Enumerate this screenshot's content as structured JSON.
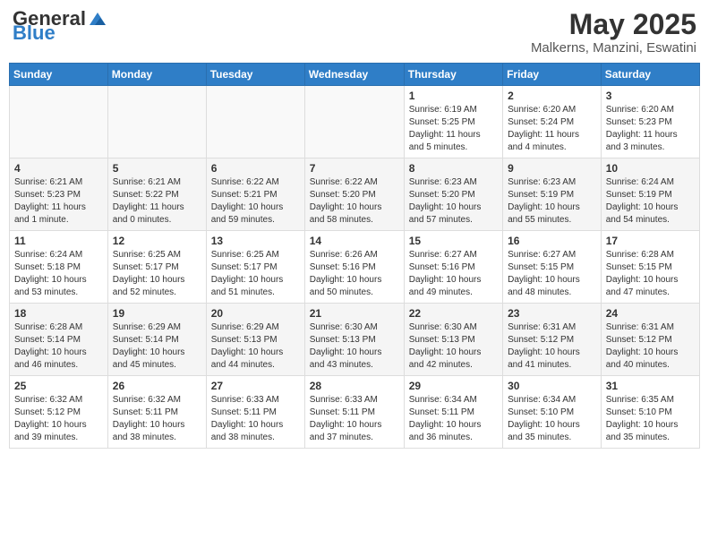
{
  "header": {
    "logo_general": "General",
    "logo_blue": "Blue",
    "month_title": "May 2025",
    "location": "Malkerns, Manzini, Eswatini"
  },
  "days_of_week": [
    "Sunday",
    "Monday",
    "Tuesday",
    "Wednesday",
    "Thursday",
    "Friday",
    "Saturday"
  ],
  "weeks": [
    [
      {
        "day": "",
        "info": ""
      },
      {
        "day": "",
        "info": ""
      },
      {
        "day": "",
        "info": ""
      },
      {
        "day": "",
        "info": ""
      },
      {
        "day": "1",
        "info": "Sunrise: 6:19 AM\nSunset: 5:25 PM\nDaylight: 11 hours\nand 5 minutes."
      },
      {
        "day": "2",
        "info": "Sunrise: 6:20 AM\nSunset: 5:24 PM\nDaylight: 11 hours\nand 4 minutes."
      },
      {
        "day": "3",
        "info": "Sunrise: 6:20 AM\nSunset: 5:23 PM\nDaylight: 11 hours\nand 3 minutes."
      }
    ],
    [
      {
        "day": "4",
        "info": "Sunrise: 6:21 AM\nSunset: 5:23 PM\nDaylight: 11 hours\nand 1 minute."
      },
      {
        "day": "5",
        "info": "Sunrise: 6:21 AM\nSunset: 5:22 PM\nDaylight: 11 hours\nand 0 minutes."
      },
      {
        "day": "6",
        "info": "Sunrise: 6:22 AM\nSunset: 5:21 PM\nDaylight: 10 hours\nand 59 minutes."
      },
      {
        "day": "7",
        "info": "Sunrise: 6:22 AM\nSunset: 5:20 PM\nDaylight: 10 hours\nand 58 minutes."
      },
      {
        "day": "8",
        "info": "Sunrise: 6:23 AM\nSunset: 5:20 PM\nDaylight: 10 hours\nand 57 minutes."
      },
      {
        "day": "9",
        "info": "Sunrise: 6:23 AM\nSunset: 5:19 PM\nDaylight: 10 hours\nand 55 minutes."
      },
      {
        "day": "10",
        "info": "Sunrise: 6:24 AM\nSunset: 5:19 PM\nDaylight: 10 hours\nand 54 minutes."
      }
    ],
    [
      {
        "day": "11",
        "info": "Sunrise: 6:24 AM\nSunset: 5:18 PM\nDaylight: 10 hours\nand 53 minutes."
      },
      {
        "day": "12",
        "info": "Sunrise: 6:25 AM\nSunset: 5:17 PM\nDaylight: 10 hours\nand 52 minutes."
      },
      {
        "day": "13",
        "info": "Sunrise: 6:25 AM\nSunset: 5:17 PM\nDaylight: 10 hours\nand 51 minutes."
      },
      {
        "day": "14",
        "info": "Sunrise: 6:26 AM\nSunset: 5:16 PM\nDaylight: 10 hours\nand 50 minutes."
      },
      {
        "day": "15",
        "info": "Sunrise: 6:27 AM\nSunset: 5:16 PM\nDaylight: 10 hours\nand 49 minutes."
      },
      {
        "day": "16",
        "info": "Sunrise: 6:27 AM\nSunset: 5:15 PM\nDaylight: 10 hours\nand 48 minutes."
      },
      {
        "day": "17",
        "info": "Sunrise: 6:28 AM\nSunset: 5:15 PM\nDaylight: 10 hours\nand 47 minutes."
      }
    ],
    [
      {
        "day": "18",
        "info": "Sunrise: 6:28 AM\nSunset: 5:14 PM\nDaylight: 10 hours\nand 46 minutes."
      },
      {
        "day": "19",
        "info": "Sunrise: 6:29 AM\nSunset: 5:14 PM\nDaylight: 10 hours\nand 45 minutes."
      },
      {
        "day": "20",
        "info": "Sunrise: 6:29 AM\nSunset: 5:13 PM\nDaylight: 10 hours\nand 44 minutes."
      },
      {
        "day": "21",
        "info": "Sunrise: 6:30 AM\nSunset: 5:13 PM\nDaylight: 10 hours\nand 43 minutes."
      },
      {
        "day": "22",
        "info": "Sunrise: 6:30 AM\nSunset: 5:13 PM\nDaylight: 10 hours\nand 42 minutes."
      },
      {
        "day": "23",
        "info": "Sunrise: 6:31 AM\nSunset: 5:12 PM\nDaylight: 10 hours\nand 41 minutes."
      },
      {
        "day": "24",
        "info": "Sunrise: 6:31 AM\nSunset: 5:12 PM\nDaylight: 10 hours\nand 40 minutes."
      }
    ],
    [
      {
        "day": "25",
        "info": "Sunrise: 6:32 AM\nSunset: 5:12 PM\nDaylight: 10 hours\nand 39 minutes."
      },
      {
        "day": "26",
        "info": "Sunrise: 6:32 AM\nSunset: 5:11 PM\nDaylight: 10 hours\nand 38 minutes."
      },
      {
        "day": "27",
        "info": "Sunrise: 6:33 AM\nSunset: 5:11 PM\nDaylight: 10 hours\nand 38 minutes."
      },
      {
        "day": "28",
        "info": "Sunrise: 6:33 AM\nSunset: 5:11 PM\nDaylight: 10 hours\nand 37 minutes."
      },
      {
        "day": "29",
        "info": "Sunrise: 6:34 AM\nSunset: 5:11 PM\nDaylight: 10 hours\nand 36 minutes."
      },
      {
        "day": "30",
        "info": "Sunrise: 6:34 AM\nSunset: 5:10 PM\nDaylight: 10 hours\nand 35 minutes."
      },
      {
        "day": "31",
        "info": "Sunrise: 6:35 AM\nSunset: 5:10 PM\nDaylight: 10 hours\nand 35 minutes."
      }
    ]
  ]
}
